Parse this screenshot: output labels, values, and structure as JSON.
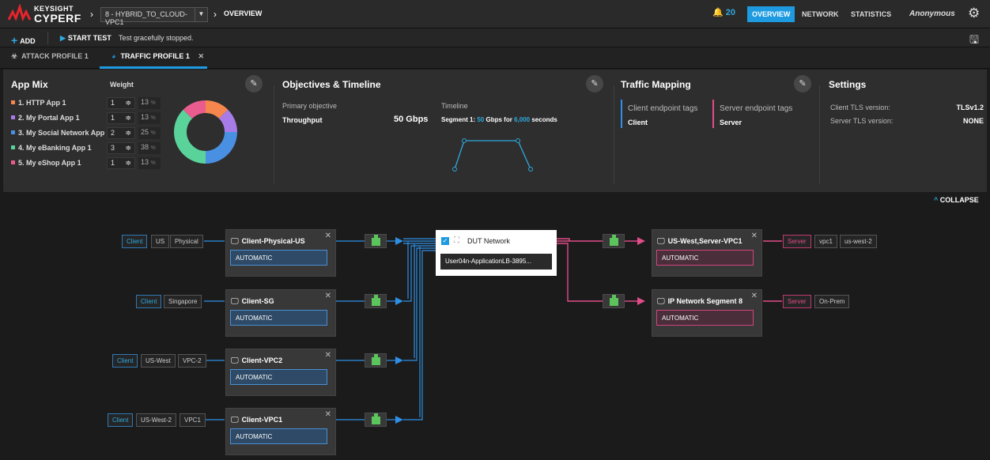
{
  "header": {
    "brand_top": "KEYSIGHT",
    "brand_bottom": "CYPERF",
    "project": "8 - HYBRID_TO_CLOUD-VPC1",
    "crumb": "OVERVIEW",
    "notifications": "20",
    "nav": [
      "OVERVIEW",
      "NETWORK",
      "STATISTICS"
    ],
    "user": "Anonymous"
  },
  "toolbar": {
    "add_label": "ADD",
    "start_label": "START TEST",
    "status": "Test gracefully stopped."
  },
  "tabs": [
    {
      "label": "ATTACK PROFILE 1"
    },
    {
      "label": "TRAFFIC PROFILE 1"
    }
  ],
  "app_mix": {
    "title": "App Mix",
    "weight_label": "Weight",
    "apps": [
      {
        "name": "1. HTTP App 1",
        "weight": "1",
        "pct": "13",
        "color": "#f5874e"
      },
      {
        "name": "2. My Portal App 1",
        "weight": "1",
        "pct": "13",
        "color": "#a87ce8"
      },
      {
        "name": "3. My Social Network App 1",
        "weight": "2",
        "pct": "25",
        "color": "#4a90e2"
      },
      {
        "name": "4. My eBanking App 1",
        "weight": "3",
        "pct": "38",
        "color": "#5ad39a"
      },
      {
        "name": "5. My eShop App 1",
        "weight": "1",
        "pct": "13",
        "color": "#ea5c8e"
      }
    ]
  },
  "objectives": {
    "title": "Objectives & Timeline",
    "primary_label": "Primary objective",
    "primary_value": "Throughput",
    "primary_amount": "50 Gbps",
    "timeline_label": "Timeline",
    "segment_prefix": "Segment 1:",
    "segment_rate": "50",
    "segment_mid": "Gbps for",
    "segment_duration": "6,000",
    "segment_suffix": "seconds"
  },
  "traffic_mapping": {
    "title": "Traffic Mapping",
    "client_label": "Client endpoint tags",
    "client_value": "Client",
    "server_label": "Server endpoint tags",
    "server_value": "Server"
  },
  "settings": {
    "title": "Settings",
    "client_tls_label": "Client TLS version:",
    "client_tls_value": "TLSv1.2",
    "server_tls_label": "Server TLS version:",
    "server_tls_value": "NONE"
  },
  "collapse_label": "COLLAPSE",
  "topology": {
    "clients": [
      {
        "tags": [
          "Client",
          "US",
          "Physical"
        ],
        "name": "Client-Physical-US",
        "mode": "AUTOMATIC"
      },
      {
        "tags": [
          "Client",
          "Singapore"
        ],
        "name": "Client-SG",
        "mode": "AUTOMATIC"
      },
      {
        "tags": [
          "Client",
          "US-West",
          "VPC-2"
        ],
        "name": "Client-VPC2",
        "mode": "AUTOMATIC"
      },
      {
        "tags": [
          "Client",
          "US-West-2",
          "VPC1"
        ],
        "name": "Client-VPC1",
        "mode": "AUTOMATIC"
      }
    ],
    "dut": {
      "title": "DUT Network",
      "value": "User04n-ApplicationLB-3895..."
    },
    "servers": [
      {
        "tags": [
          "Server",
          "vpc1",
          "us-west-2"
        ],
        "name": "US-West,Server-VPC1",
        "mode": "AUTOMATIC"
      },
      {
        "tags": [
          "Server",
          "On-Prem"
        ],
        "name": "IP Network Segment 8",
        "mode": "AUTOMATIC"
      }
    ]
  },
  "colors": {
    "accent": "#1e9be0",
    "client": "#2f8fe6",
    "server": "#e34c8a"
  }
}
